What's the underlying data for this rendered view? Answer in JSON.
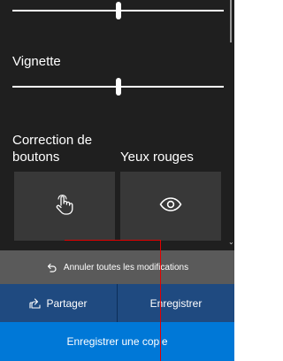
{
  "panel": {
    "sliders": [
      {
        "name": "top-adjust",
        "value": 0.5
      },
      {
        "name": "vignette",
        "value": 0.5
      }
    ],
    "vignette_label": "Vignette",
    "touch_fix_label_line1": "Correction de",
    "touch_fix_label_line2": "boutons",
    "red_eye_label": "Yeux rouges",
    "touch_fix_icon": "touch-hand-icon",
    "red_eye_icon": "eye-icon"
  },
  "reset": {
    "icon": "undo-icon",
    "label": "Annuler toutes les modifications"
  },
  "actions": {
    "share_icon": "share-icon",
    "share_label": "Partager",
    "save_label": "Enregistrer",
    "save_copy_label": "Enregistrer une copie"
  },
  "colors": {
    "panel_bg": "#1f1f1f",
    "card_bg": "#383838",
    "reset_bg": "#5a5a5a",
    "action_bg": "#1f4a80",
    "accent": "#0078d7",
    "annotation": "#e00000"
  }
}
